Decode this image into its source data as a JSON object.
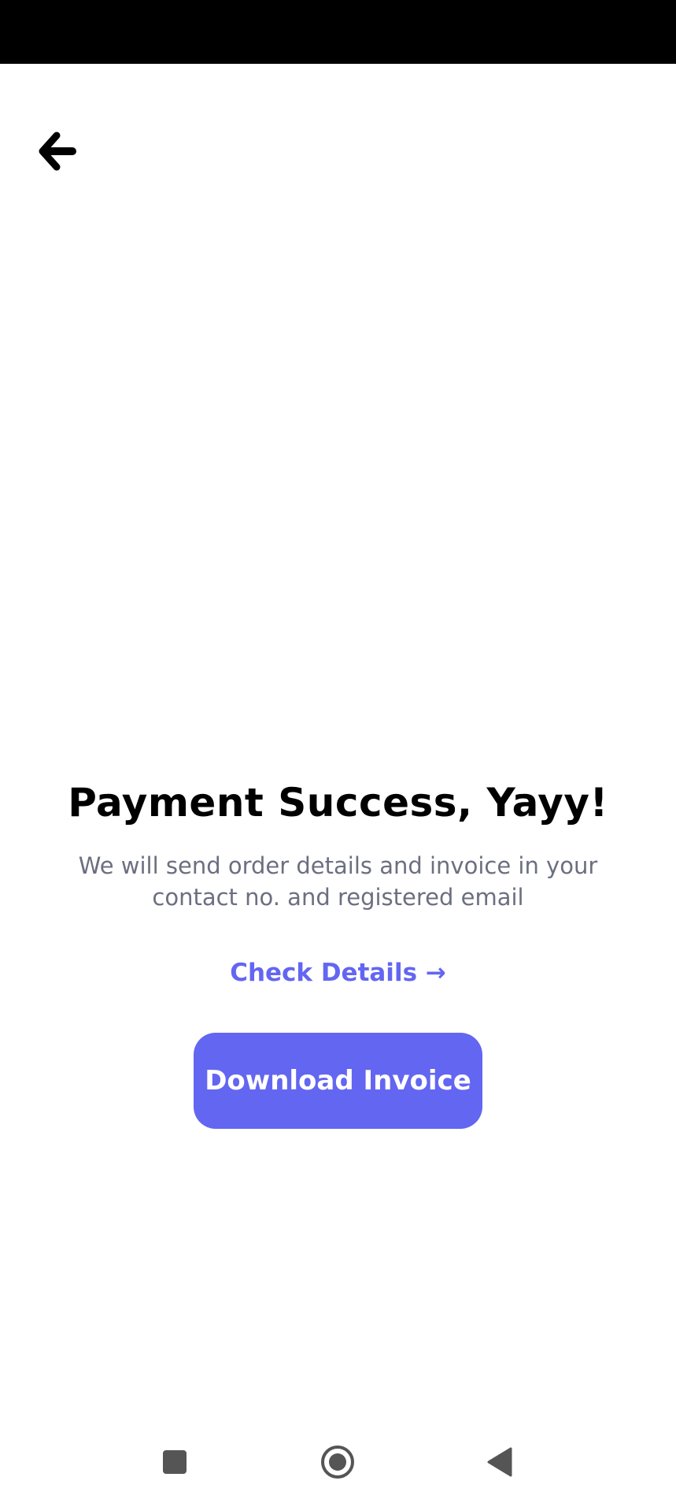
{
  "header": {
    "back_icon": "arrow-left-icon"
  },
  "main": {
    "title": "Payment Success, Yayy!",
    "subtitle": "We will send order details and invoice in your contact no. and registered email",
    "check_details_label": "Check Details →",
    "download_button_label": "Download Invoice"
  },
  "nav": {
    "recents_icon": "square-icon",
    "home_icon": "circle-home-icon",
    "back_icon": "triangle-back-icon"
  },
  "colors": {
    "accent": "#6366f1",
    "subtitle": "#6b6f80",
    "status_bar": "#000000"
  }
}
